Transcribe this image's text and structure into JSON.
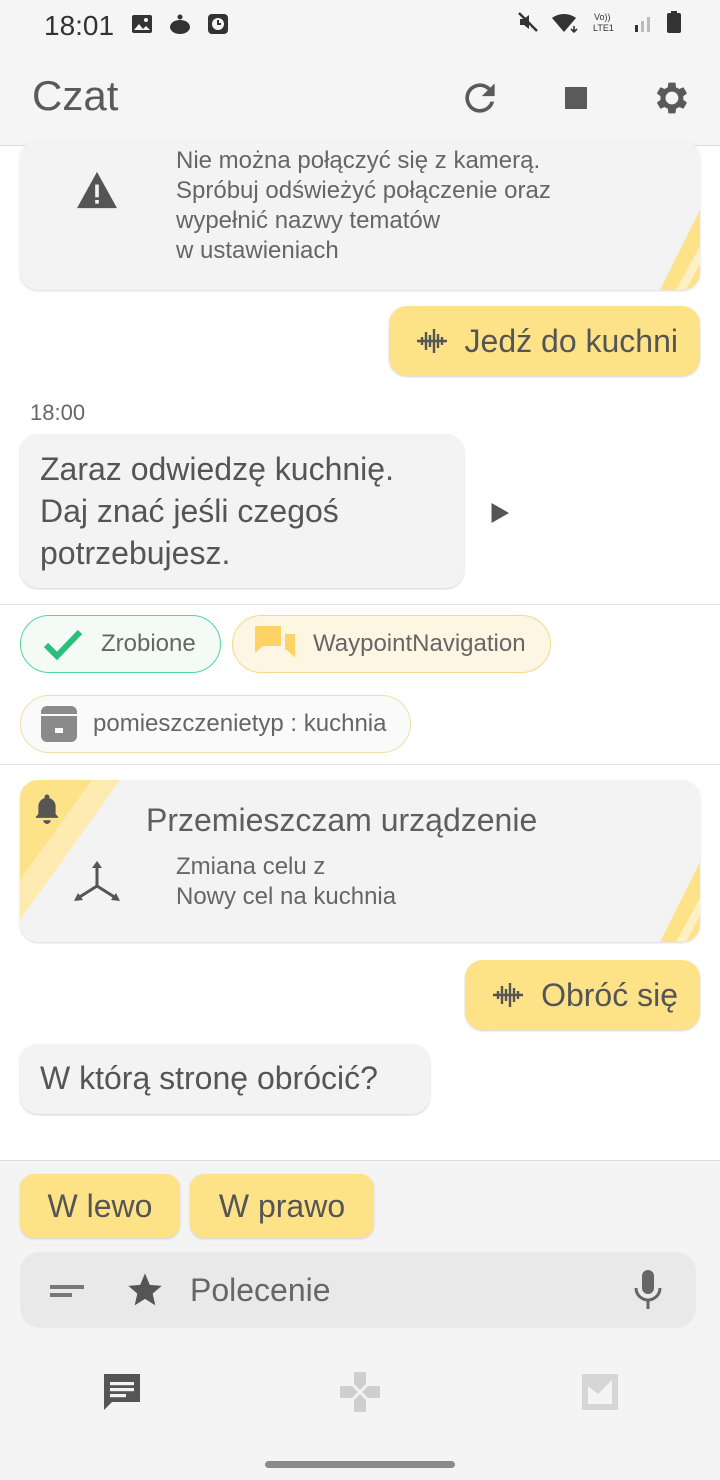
{
  "status_bar": {
    "time": "18:01"
  },
  "app_bar": {
    "title": "Czat",
    "actions": [
      "refresh-icon",
      "stop-icon",
      "settings-icon"
    ]
  },
  "messages": {
    "camera_warning": {
      "lines": [
        "Nie można połączyć się z kamerą.",
        "Spróbuj odświeżyć połączenie oraz",
        "wypełnić nazwy tematów",
        "w ustawieniach"
      ]
    },
    "user_1": "Jedź do kuchni",
    "timestamp": "18:00",
    "bot_1": [
      "Zaraz odwiedzę kuchnię.",
      "Daj znać jeśli czegoś",
      "potrzebujesz."
    ],
    "chips": {
      "done": "Zrobione",
      "intent": "WaypointNavigation",
      "param": "pomieszczenietyp : kuchnia"
    },
    "move_card": {
      "title": "Przemieszczam urządzenie",
      "lines": [
        "Zmiana celu z",
        "Nowy cel na kuchnia"
      ]
    },
    "user_2": "Obróć się",
    "bot_2": "W którą stronę obrócić?"
  },
  "quick_replies": [
    "W lewo",
    "W prawo"
  ],
  "command": {
    "placeholder": "Polecenie"
  },
  "bottom_nav": [
    "chat-icon",
    "gamepad-icon",
    "map-icon"
  ],
  "colors": {
    "accent": "#fde287",
    "done_green": "#28c07a",
    "bubble_gray": "#f3f3f3"
  }
}
